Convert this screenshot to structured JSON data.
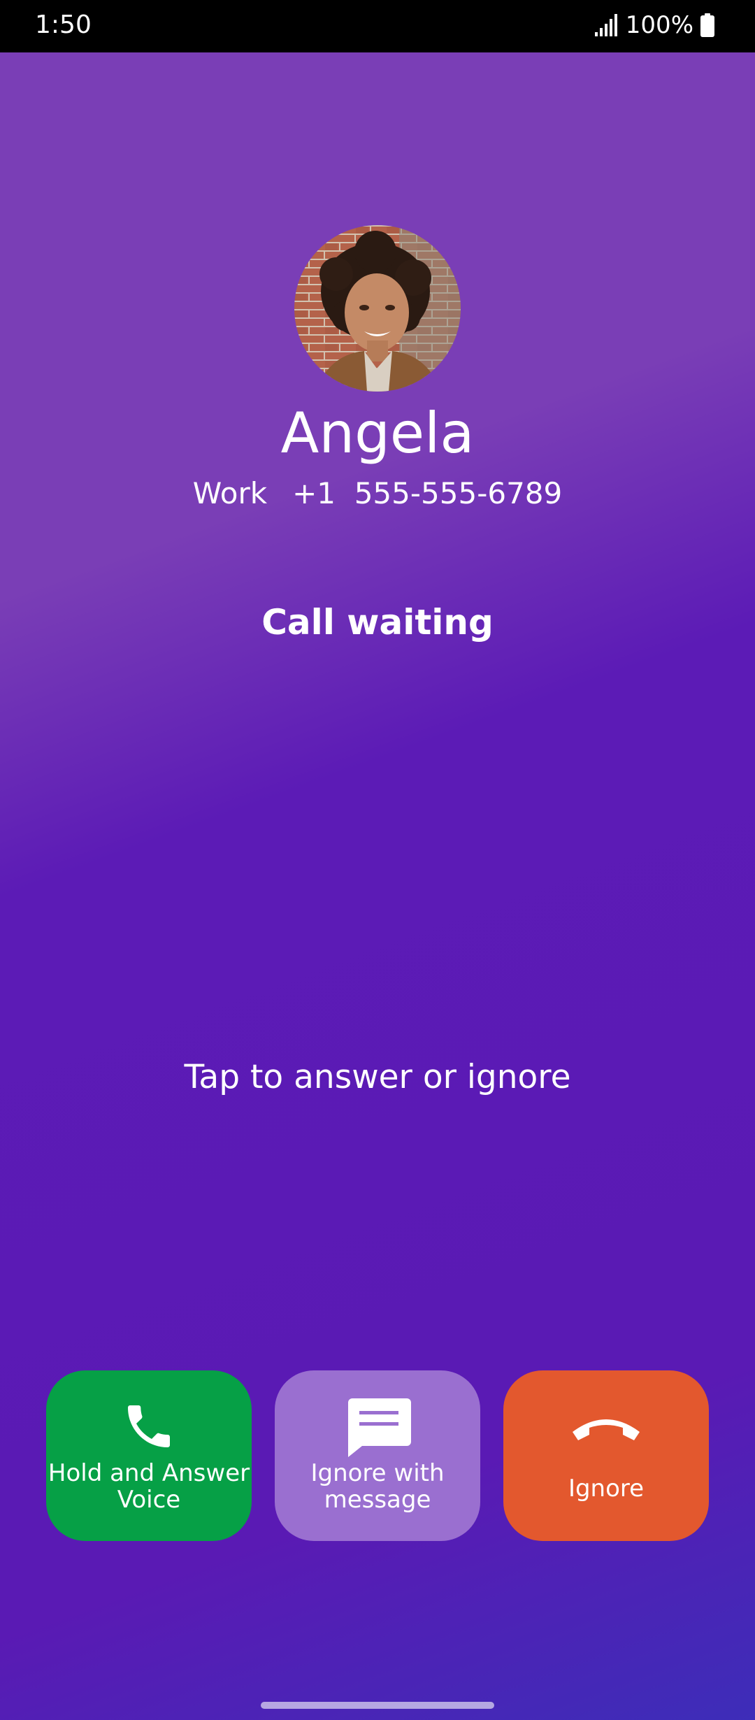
{
  "status_bar": {
    "time": "1:50",
    "battery_text": "100%",
    "signal_icon": "signal-bars-icon",
    "battery_icon": "battery-full-icon"
  },
  "caller": {
    "name": "Angela",
    "label": "Work",
    "number": "+1  555-555-6789",
    "avatar": "contact-photo"
  },
  "call": {
    "status": "Call waiting",
    "hint": "Tap to answer or ignore"
  },
  "actions": [
    {
      "label": "Hold and Answer\nVoice",
      "icon": "phone-icon",
      "color": "#06a046"
    },
    {
      "label": "Ignore with\nmessage",
      "icon": "message-bubble-icon",
      "color": "#9a6fd0"
    },
    {
      "label": "Ignore",
      "icon": "hang-up-icon",
      "color": "#e3582e"
    }
  ],
  "theme": {
    "background_top": "#7a3eb6",
    "background_bottom": "#3d2db8"
  }
}
